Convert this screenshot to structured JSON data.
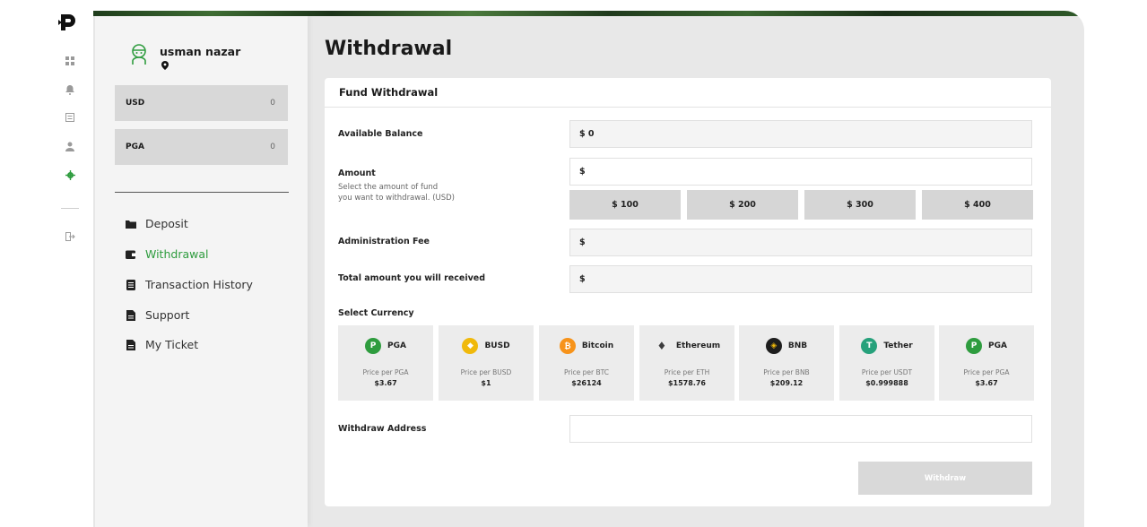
{
  "rail": {
    "icons": [
      "logo-icon",
      "grid-icon",
      "bell-icon",
      "list-icon",
      "user-icon",
      "gear-icon",
      "logout-icon"
    ]
  },
  "profile": {
    "name": "usman nazar"
  },
  "balances": [
    {
      "currency": "USD",
      "value": "0"
    },
    {
      "currency": "PGA",
      "value": "0"
    }
  ],
  "menu": [
    {
      "label": "Deposit",
      "icon": "folder-icon"
    },
    {
      "label": "Withdrawal",
      "icon": "wallet-icon"
    },
    {
      "label": "Transaction History",
      "icon": "document-icon"
    },
    {
      "label": "Support",
      "icon": "file-icon"
    },
    {
      "label": "My Ticket",
      "icon": "file-icon"
    }
  ],
  "page_title": "Withdrawal",
  "form": {
    "title": "Fund Withdrawal",
    "available_balance_label": "Available Balance",
    "available_balance_value": "$ 0",
    "amount_label": "Amount",
    "amount_help_1": "Select the amount of fund",
    "amount_help_2": "you want to withdrawal. (USD)",
    "amount_value": "$",
    "quick_amounts": [
      "$ 100",
      "$ 200",
      "$ 300",
      "$ 400"
    ],
    "fee_label": "Administration Fee",
    "fee_value": "$",
    "total_label": "Total amount you will received",
    "total_value": "$",
    "currency_label": "Select Currency",
    "currencies": [
      {
        "name": "PGA",
        "price_label": "Price per PGA",
        "price": "$3.67",
        "icon": "pga-icon",
        "color": "#2e9c3e"
      },
      {
        "name": "BUSD",
        "price_label": "Price per BUSD",
        "price": "$1",
        "icon": "busd-icon",
        "color": "#f0b90b"
      },
      {
        "name": "Bitcoin",
        "price_label": "Price per BTC",
        "price": "$26124",
        "icon": "bitcoin-icon",
        "color": "#f7931a"
      },
      {
        "name": "Ethereum",
        "price_label": "Price per ETH",
        "price": "$1578.76",
        "icon": "ethereum-icon",
        "color": "#3c3c3d"
      },
      {
        "name": "BNB",
        "price_label": "Price per BNB",
        "price": "$209.12",
        "icon": "bnb-icon",
        "color": "#1e1e1e"
      },
      {
        "name": "Tether",
        "price_label": "Price per USDT",
        "price": "$0.999888",
        "icon": "tether-icon",
        "color": "#26a17b"
      },
      {
        "name": "PGA",
        "price_label": "Price per PGA",
        "price": "$3.67",
        "icon": "pga-icon",
        "color": "#2e9c3e"
      }
    ],
    "address_label": "Withdraw Address",
    "address_value": "",
    "submit_label": "Withdraw"
  },
  "colors": {
    "accent": "#2e9c3e",
    "frame": "#e8e8e8",
    "button": "#d6d6d6"
  }
}
